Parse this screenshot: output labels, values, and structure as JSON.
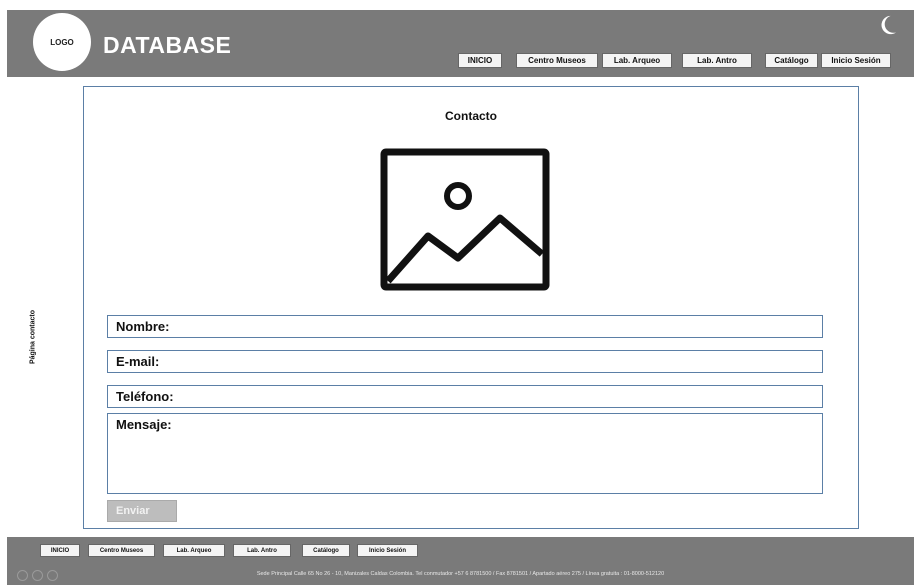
{
  "header": {
    "logo_text": "LOGO",
    "brand": "DATABASE",
    "nav": [
      "INICIO",
      "Centro Museos",
      "Lab. Arqueo",
      "Lab. Antro",
      "Catálogo",
      "Inicio Sesión"
    ]
  },
  "sidebar": {
    "label": "Página contacto"
  },
  "main": {
    "title": "Contacto",
    "fields": {
      "nombre": "Nombre:",
      "email": "E-mail:",
      "telefono": "Teléfono:",
      "mensaje": "Mensaje:"
    },
    "submit": "Enviar"
  },
  "footer": {
    "nav": [
      "INICIO",
      "Centro Museos",
      "Lab. Arqueo",
      "Lab. Antro",
      "Catálogo",
      "Inicio Sesión"
    ],
    "text": "Sede Principal Calle 65 No 26 - 10, Manizales Caldas Colombia. Tel conmutador +57 6 8781500 / Fax 8781501 / Apartado aéreo 275 / Línea gratuita : 01-8000-512120"
  },
  "colors": {
    "bar": "#7a7a7a",
    "border_accent": "#5b7fa6"
  },
  "icons": [
    "moon-icon",
    "image-placeholder-icon"
  ]
}
